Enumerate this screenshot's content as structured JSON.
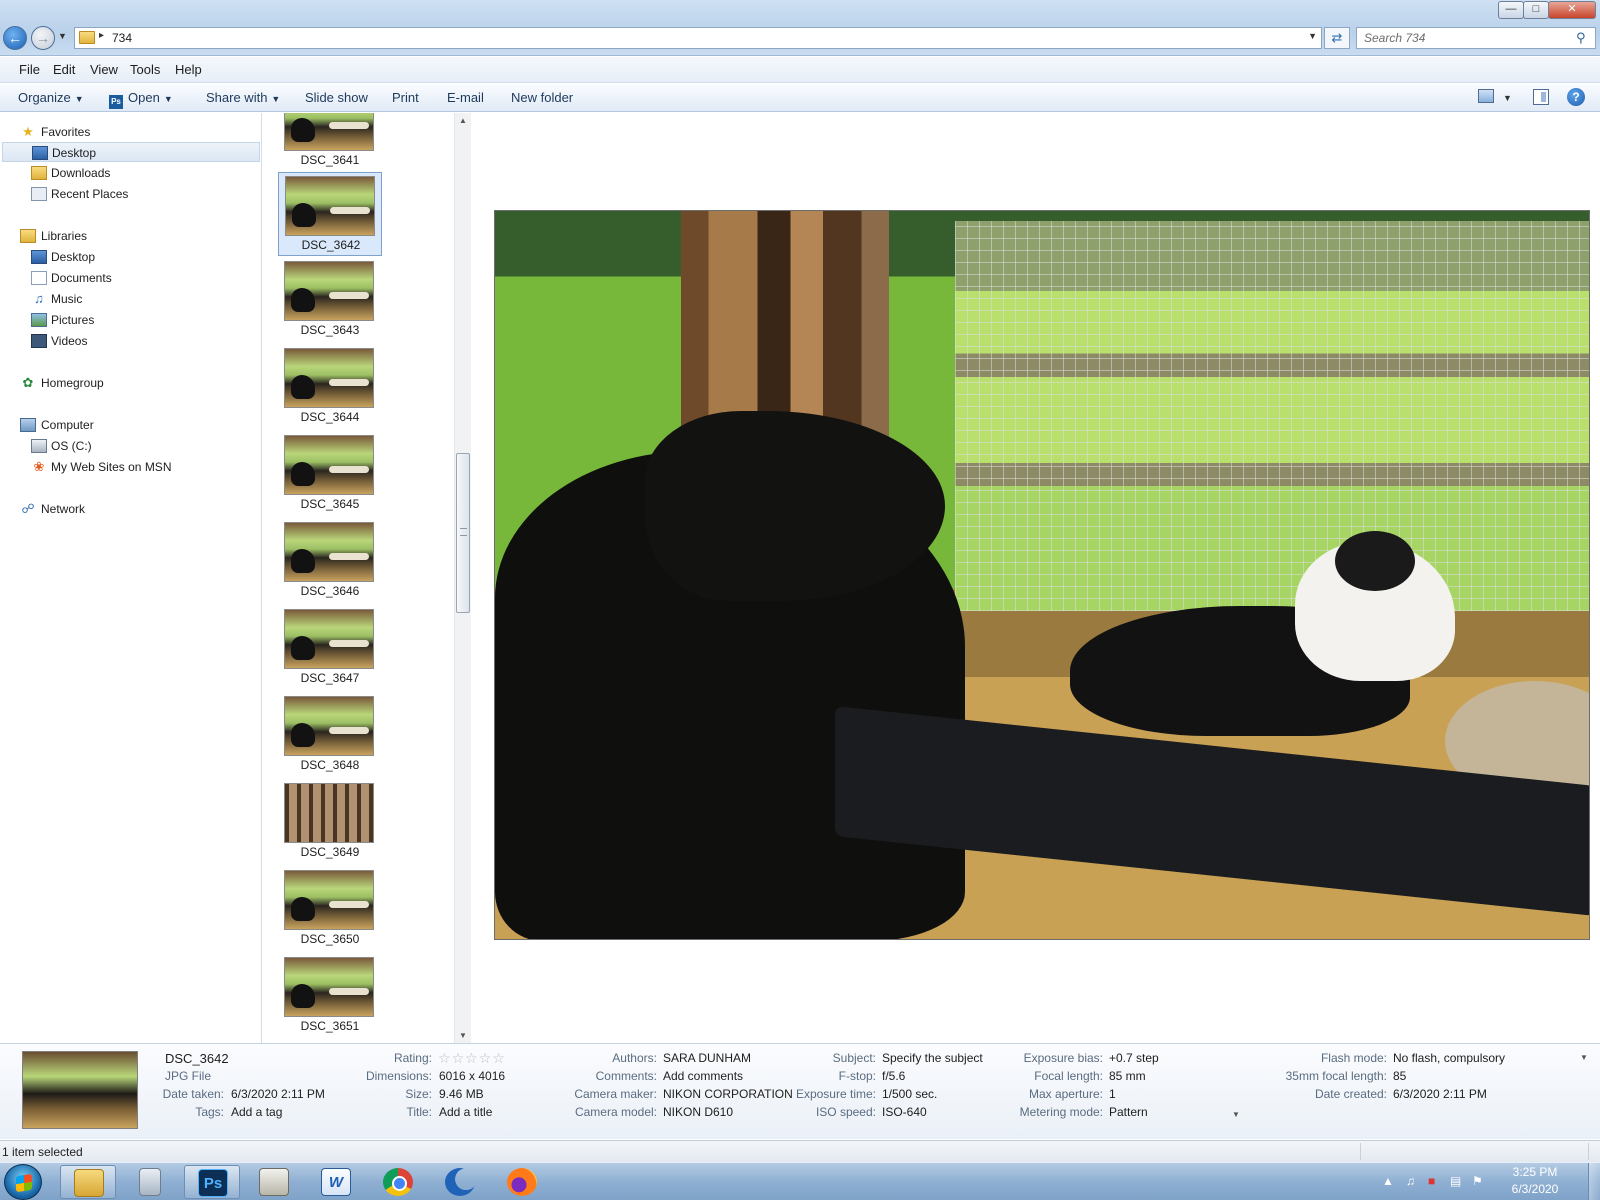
{
  "address": {
    "path": "734",
    "search_placeholder": "Search 734"
  },
  "menu": [
    "File",
    "Edit",
    "View",
    "Tools",
    "Help"
  ],
  "toolbar": {
    "organize": "Organize",
    "open": "Open",
    "share_with": "Share with",
    "slide_show": "Slide show",
    "print": "Print",
    "email": "E-mail",
    "new_folder": "New folder"
  },
  "nav": {
    "favorites": "Favorites",
    "fav_items": [
      "Desktop",
      "Downloads",
      "Recent Places"
    ],
    "libraries": "Libraries",
    "lib_items": [
      "Desktop",
      "Documents",
      "Music",
      "Pictures",
      "Videos"
    ],
    "homegroup": "Homegroup",
    "computer": "Computer",
    "comp_items": [
      "OS (C:)",
      "My Web Sites on MSN"
    ],
    "network": "Network"
  },
  "thumbnails": [
    "DSC_3641",
    "DSC_3642",
    "DSC_3643",
    "DSC_3644",
    "DSC_3645",
    "DSC_3646",
    "DSC_3647",
    "DSC_3648",
    "DSC_3649",
    "DSC_3650",
    "DSC_3651"
  ],
  "selected_file": "DSC_3642",
  "details": {
    "name": "DSC_3642",
    "type": "JPG File",
    "date_taken_label": "Date taken:",
    "date_taken": "6/3/2020 2:11 PM",
    "tags_label": "Tags:",
    "tags": "Add a tag",
    "rating_label": "Rating:",
    "rating": 0,
    "dimensions_label": "Dimensions:",
    "dimensions": "6016 x 4016",
    "size_label": "Size:",
    "size": "9.46 MB",
    "title_label": "Title:",
    "title": "Add a title",
    "authors_label": "Authors:",
    "authors": "SARA DUNHAM",
    "comments_label": "Comments:",
    "comments": "Add comments",
    "camera_maker_label": "Camera maker:",
    "camera_maker": "NIKON CORPORATION",
    "camera_model_label": "Camera model:",
    "camera_model": "NIKON D610",
    "subject_label": "Subject:",
    "subject": "Specify the subject",
    "fstop_label": "F-stop:",
    "fstop": "f/5.6",
    "exposure_time_label": "Exposure time:",
    "exposure_time": "1/500 sec.",
    "iso_label": "ISO speed:",
    "iso": "ISO-640",
    "exposure_bias_label": "Exposure bias:",
    "exposure_bias": "+0.7 step",
    "focal_length_label": "Focal length:",
    "focal_length": "85 mm",
    "max_aperture_label": "Max aperture:",
    "max_aperture": "1",
    "metering_label": "Metering mode:",
    "metering": "Pattern",
    "flash_label": "Flash mode:",
    "flash": "No flash, compulsory",
    "focal35_label": "35mm focal length:",
    "focal35": "85",
    "date_created_label": "Date created:",
    "date_created": "6/3/2020 2:11 PM"
  },
  "status": {
    "text": "1 item selected"
  },
  "taskbar": {
    "apps": [
      "windows-explorer",
      "calculator",
      "photoshop",
      "scanner-app",
      "word",
      "chrome",
      "moon-app",
      "firefox"
    ],
    "time": "3:25 PM",
    "date": "6/3/2020"
  },
  "colors": {
    "selection": "#d9e8fb",
    "accent": "#1e395b",
    "taskbar": "#8fb0d3"
  }
}
